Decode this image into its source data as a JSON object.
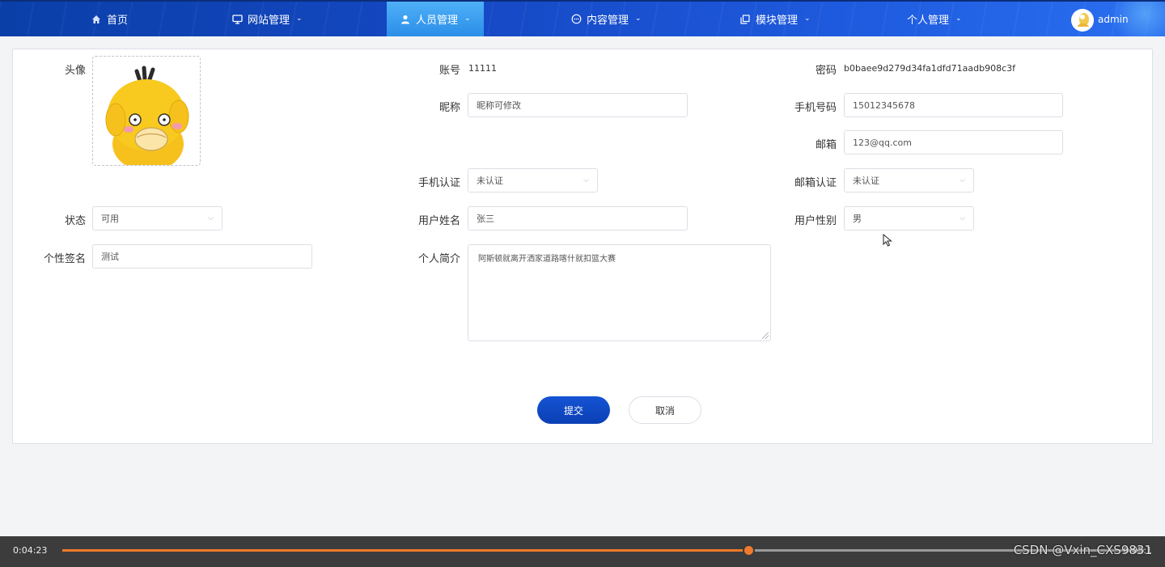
{
  "nav": {
    "items": [
      {
        "label": "首页",
        "icon": "home-icon"
      },
      {
        "label": "网站管理",
        "icon": "monitor-icon"
      },
      {
        "label": "人员管理",
        "icon": "user-icon",
        "active": true
      },
      {
        "label": "内容管理",
        "icon": "chat-icon"
      },
      {
        "label": "模块管理",
        "icon": "copy-icon"
      },
      {
        "label": "个人管理",
        "icon": ""
      }
    ],
    "username": "admin"
  },
  "form": {
    "avatar_label": "头像",
    "account_label": "账号",
    "account_value": "11111",
    "password_label": "密码",
    "password_value": "b0baee9d279d34fa1dfd71aadb908c3f",
    "nickname_label": "昵称",
    "nickname_value": "昵称可修改",
    "phone_label": "手机号码",
    "phone_value": "15012345678",
    "email_label": "邮箱",
    "email_value": "123@qq.com",
    "phone_verify_label": "手机认证",
    "phone_verify_value": "未认证",
    "email_verify_label": "邮箱认证",
    "email_verify_value": "未认证",
    "status_label": "状态",
    "status_value": "可用",
    "realname_label": "用户姓名",
    "realname_value": "张三",
    "gender_label": "用户性别",
    "gender_value": "男",
    "signature_label": "个性签名",
    "signature_value": "测试",
    "bio_label": "个人简介",
    "bio_value": "阿斯顿就离开洒家道路喀什就扣篮大赛",
    "submit_label": "提交",
    "cancel_label": "取消"
  },
  "player": {
    "current_time": "0:04:23",
    "total_time": "0:05:1",
    "progress": 0.634,
    "watermark": "CSDN @Vxin_CXS9831"
  },
  "colors": {
    "accent": "#0b3fb4",
    "progress": "#f07a2b"
  }
}
